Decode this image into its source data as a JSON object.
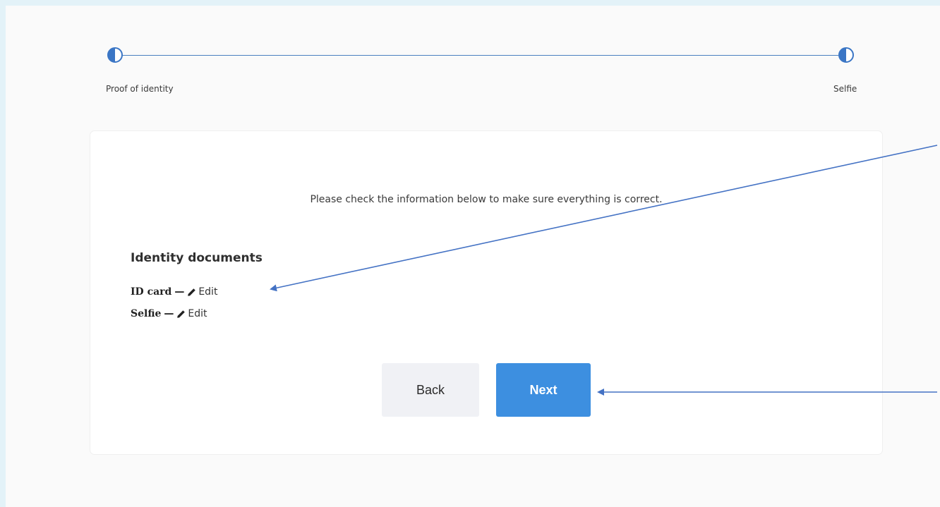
{
  "stepper": {
    "steps": [
      {
        "label": "Proof of identity"
      },
      {
        "label": "Selfie"
      }
    ],
    "accent": "#3b76c5"
  },
  "card": {
    "intro": "Please check the information below to make sure everything is correct.",
    "section_title": "Identity documents",
    "documents": [
      {
        "name": "ID card",
        "separator": "—",
        "edit_label": "Edit",
        "icon": "pencil-icon"
      },
      {
        "name": "Selfie",
        "separator": "—",
        "edit_label": "Edit",
        "icon": "pencil-icon"
      }
    ]
  },
  "actions": {
    "back_label": "Back",
    "next_label": "Next",
    "next_color": "#3d8fe0",
    "back_color": "#f0f1f5"
  },
  "annotations": {
    "arrow_color": "#4472c4"
  }
}
